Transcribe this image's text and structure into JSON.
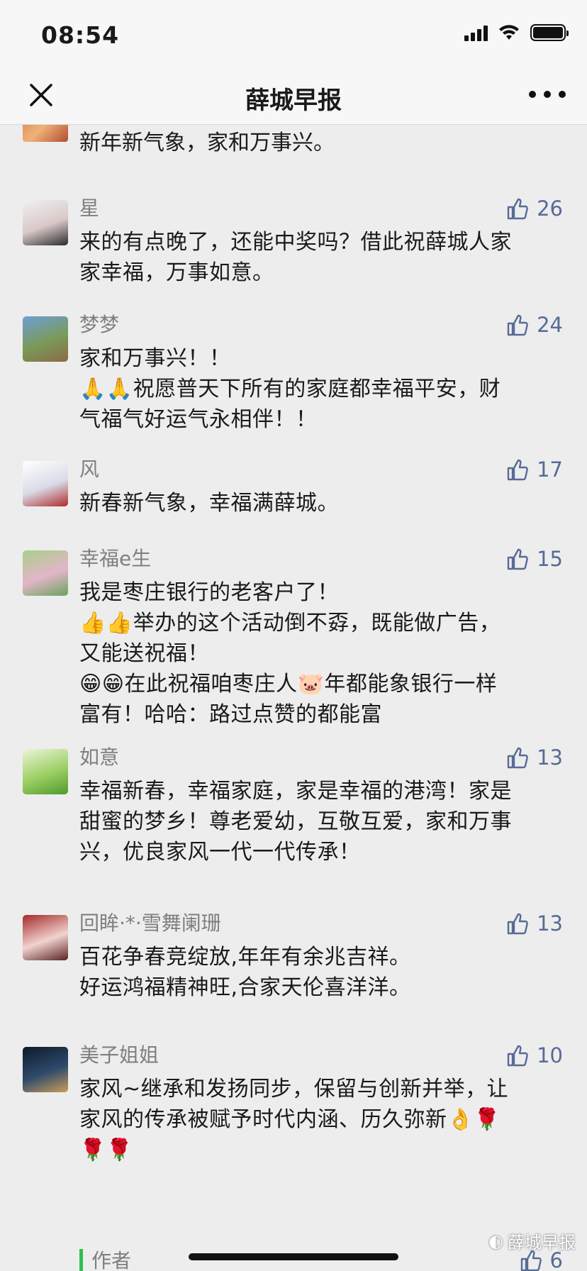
{
  "status_bar": {
    "time": "08:54"
  },
  "nav": {
    "title": "薛城早报"
  },
  "top_partial_comment": {
    "text": "新年新气象，家和万事兴。"
  },
  "comments": [
    {
      "nickname": "星",
      "likes": "26",
      "text": "来的有点晚了，还能中奖吗？借此祝薛城人家\n家幸福，万事如意。",
      "avatar_colors": [
        "#f0f0f0",
        "#d9c8c8",
        "#2b2b2b"
      ]
    },
    {
      "nickname": "梦梦",
      "likes": "24",
      "text": "家和万事兴！！\n🙏🙏祝愿普天下所有的家庭都幸福平安，财\n气福气好运气永相伴！！",
      "avatar_colors": [
        "#6f9ed6",
        "#7a9a59",
        "#8a6a45"
      ]
    },
    {
      "nickname": "风",
      "likes": "17",
      "text": "新春新气象，幸福满薛城。",
      "avatar_colors": [
        "#ffffff",
        "#d9dce8",
        "#b02a2a"
      ]
    },
    {
      "nickname": "幸福e生",
      "likes": "15",
      "text": "我是枣庄银行的老客户了！\n👍👍举办的这个活动倒不孬，既能做广告，\n又能送祝福！\n😁😁在此祝福咱枣庄人🐷年都能象银行一样\n富有！哈哈：路过点赞的都能富",
      "avatar_colors": [
        "#a9cf8a",
        "#e3b5c8",
        "#6aa35c"
      ]
    },
    {
      "nickname": "如意",
      "likes": "13",
      "text": "幸福新春，幸福家庭，家是幸福的港湾！家是\n甜蜜的梦乡！尊老爱幼，互敬互爱，家和万事\n兴，优良家风一代一代传承！",
      "avatar_colors": [
        "#eaf5d8",
        "#9ccf63",
        "#4f9a2d"
      ]
    },
    {
      "nickname": "回眸·*·雪舞阑珊",
      "likes": "13",
      "text": "百花争春竞绽放,年年有余兆吉祥。\n好运鸿福精神旺,合家天伦喜洋洋。",
      "avatar_colors": [
        "#a32a2a",
        "#f1d3cf",
        "#5a2222"
      ]
    },
    {
      "nickname": "美子姐姐",
      "likes": "10",
      "text": "家风~继承和发扬同步，保留与创新并举，让\n家风的传承被赋予时代内涵、历久弥新👌🌹\n🌹🌹",
      "avatar_colors": [
        "#0d1a2a",
        "#2e4a6b",
        "#c99c5a"
      ]
    }
  ],
  "author_reply": {
    "label": "作者",
    "likes": "6"
  },
  "watermark": {
    "text": "薛城早报"
  },
  "colors": {
    "like_blue": "#576b95",
    "nickname_gray": "#7f7f7f",
    "author_green": "#30c04e"
  }
}
